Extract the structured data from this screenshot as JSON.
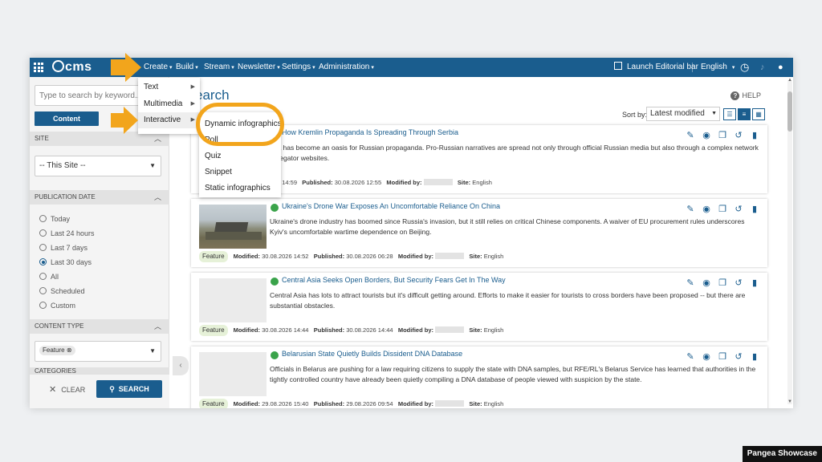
{
  "topbar": {
    "logo": "cms",
    "menus": [
      "Create",
      "Build",
      "Stream",
      "Newsletter",
      "Settings",
      "Administration"
    ],
    "launch_editorial": "Launch Editorial bar",
    "language": "English"
  },
  "create_menu": {
    "items": [
      "Text",
      "Multimedia",
      "Interactive"
    ]
  },
  "interactive_menu": {
    "items": [
      "Dynamic infographics",
      "Poll",
      "Quiz",
      "Snippet",
      "Static infographics"
    ]
  },
  "sidebar": {
    "search_placeholder": "Type to search by keyword...",
    "content_button": "Content",
    "site_header": "SITE",
    "site_value": "-- This Site --",
    "pubdate_header": "PUBLICATION DATE",
    "pubdate_options": [
      "Today",
      "Last 24 hours",
      "Last 7 days",
      "Last 30 days",
      "All",
      "Scheduled",
      "Custom"
    ],
    "pubdate_selected": "Last 30 days",
    "content_type_header": "CONTENT TYPE",
    "content_type_chip": "Feature",
    "categories_header": "CATEGORIES",
    "clear_label": "CLEAR",
    "search_label": "SEARCH"
  },
  "main": {
    "title": "earch",
    "results_label": "ults",
    "help": "HELP",
    "sort_label": "Sort by:",
    "sort_value": "Latest modified"
  },
  "cards": [
    {
      "title": "How Kremlin Propaganda Is Spreading Through Serbia",
      "summary": "rbia has become an oasis for Russian propaganda. Pro-Russian narratives are spread not only through official Russian media but also through a complex network of regator websites.",
      "badge": "",
      "modified_label": "",
      "modified": "6 14:59",
      "published_label": "Published:",
      "published": "30.08.2026 12:55",
      "modified_by_label": "Modified by:",
      "site_label": "Site:",
      "site": "English"
    },
    {
      "title": "Ukraine's Drone War Exposes An Uncomfortable Reliance On China",
      "summary": "Ukraine's drone industry has boomed since Russia's invasion, but it still relies on critical Chinese components. A waiver of EU procurement rules underscores Kyiv's uncomfortable wartime dependence on Beijing.",
      "badge": "Feature",
      "modified_label": "Modified:",
      "modified": "30.08.2026 14:52",
      "published_label": "Published:",
      "published": "30.08.2026 06:28",
      "modified_by_label": "Modified by:",
      "site_label": "Site:",
      "site": "English"
    },
    {
      "title": "Central Asia Seeks Open Borders, But Security Fears Get In The Way",
      "summary": "Central Asia has lots to attract tourists but it's difficult getting around. Efforts to make it easier for tourists to cross borders have been proposed -- but there are substantial obstacles.",
      "badge": "Feature",
      "modified_label": "Modified:",
      "modified": "30.08.2026 14:44",
      "published_label": "Published:",
      "published": "30.08.2026 14:44",
      "modified_by_label": "Modified by:",
      "site_label": "Site:",
      "site": "English"
    },
    {
      "title": "Belarusian State Quietly Builds Dissident DNA Database",
      "summary": "Officials in Belarus are pushing for a law requiring citizens to supply the state with DNA samples, but RFE/RL's Belarus Service has learned that authorities in the tightly controlled country have already been quietly compiling a DNA database of people viewed with suspicion by the state.",
      "badge": "Feature",
      "modified_label": "Modified:",
      "modified": "29.08.2026 15:40",
      "published_label": "Published:",
      "published": "29.08.2026 09:54",
      "modified_by_label": "Modified by:",
      "site_label": "Site:",
      "site": "English"
    }
  ],
  "watermark": "Pangea Showcase",
  "colors": {
    "brand": "#1a5d8e",
    "annotation": "#f2a51c",
    "online": "#3aa34a"
  }
}
